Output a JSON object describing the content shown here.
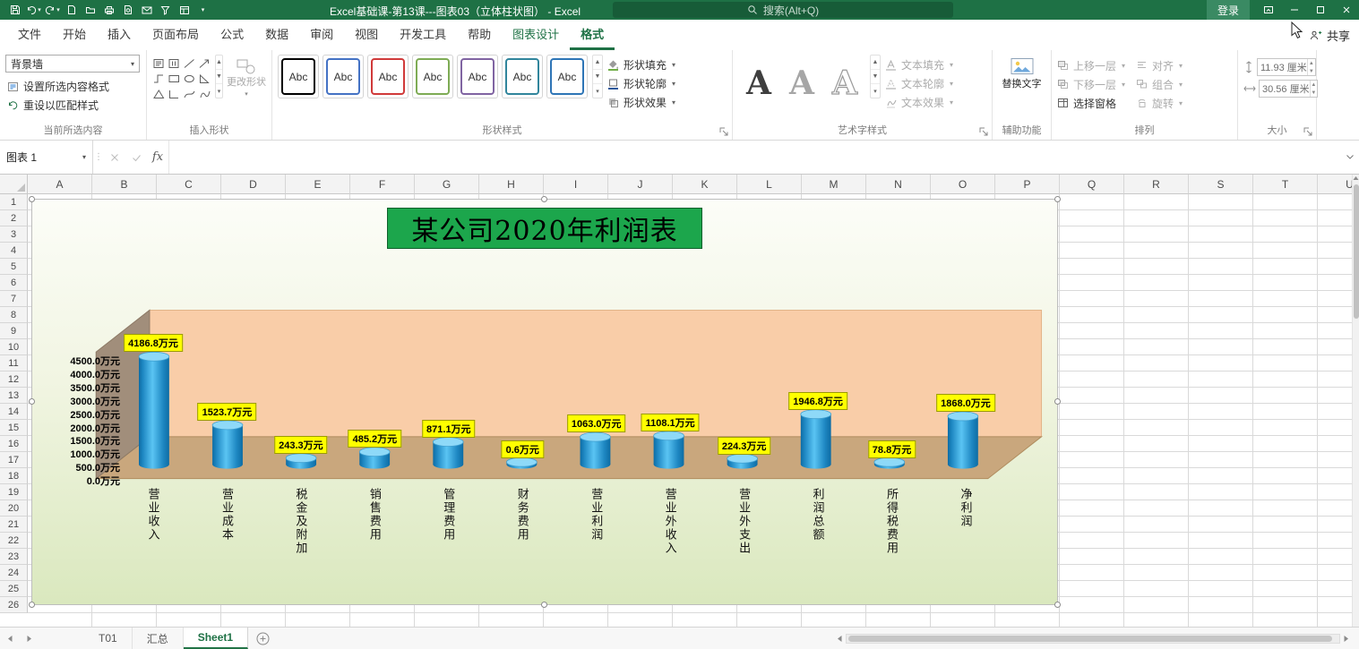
{
  "titlebar": {
    "title": "Excel基础课-第13课---图表03（立体柱状图） - Excel",
    "search_placeholder": "搜索(Alt+Q)",
    "login_label": "登录"
  },
  "icons": {
    "caret_down": "▾",
    "arrow_up": "▲",
    "arrow_down": "▼",
    "dots_vertical": "⋮"
  },
  "ribbon": {
    "share_label": "共享",
    "tabs": [
      {
        "id": "file",
        "label": "文件"
      },
      {
        "id": "home",
        "label": "开始"
      },
      {
        "id": "insert",
        "label": "插入"
      },
      {
        "id": "page-layout",
        "label": "页面布局"
      },
      {
        "id": "formulas",
        "label": "公式"
      },
      {
        "id": "data",
        "label": "数据"
      },
      {
        "id": "review",
        "label": "审阅"
      },
      {
        "id": "view",
        "label": "视图"
      },
      {
        "id": "developer",
        "label": "开发工具"
      },
      {
        "id": "help",
        "label": "帮助"
      },
      {
        "id": "chart-design",
        "label": "图表设计",
        "contextual": true
      },
      {
        "id": "format",
        "label": "格式",
        "contextual": true,
        "active": true
      }
    ],
    "groups": {
      "current_selection": {
        "label": "当前所选内容",
        "selector_value": "背景墙",
        "format_button": "设置所选内容格式",
        "reset_button": "重设以匹配样式"
      },
      "insert_shapes": {
        "label": "插入形状",
        "change_shape_button": "更改形状",
        "shapes": [
          "text-box",
          "vertical-text-box",
          "line",
          "arrow",
          "connector",
          "rectangle",
          "oval",
          "right-triangle",
          "triangle",
          "l-shape",
          "curve",
          "scribble"
        ]
      },
      "shape_styles": {
        "label": "形状样式",
        "fill_button": "形状填充",
        "outline_button": "形状轮廓",
        "effects_button": "形状效果",
        "presets": [
          {
            "label": "Abc",
            "border_color": "#000000"
          },
          {
            "label": "Abc",
            "border_color": "#4472C4"
          },
          {
            "label": "Abc",
            "border_color": "#D03A3A"
          },
          {
            "label": "Abc",
            "border_color": "#7EAB55"
          },
          {
            "label": "Abc",
            "border_color": "#8064A2"
          },
          {
            "label": "Abc",
            "border_color": "#31859C"
          },
          {
            "label": "Abc",
            "border_color": "#2E75B6"
          }
        ]
      },
      "wordart_styles": {
        "label": "艺术字样式",
        "text_fill_button": "文本填充",
        "text_outline_button": "文本轮廓",
        "text_effects_button": "文本效果",
        "samples": [
          {
            "label": "A",
            "style": "dark"
          },
          {
            "label": "A",
            "style": "gray"
          },
          {
            "label": "A",
            "style": "outline"
          }
        ]
      },
      "accessibility": {
        "label": "辅助功能",
        "alt_text_button": "替换文字"
      },
      "arrange": {
        "label": "排列",
        "bring_forward": "上移一层",
        "send_backward": "下移一层",
        "selection_pane": "选择窗格",
        "align": "对齐",
        "group": "组合",
        "rotate": "旋转"
      },
      "size": {
        "label": "大小",
        "height_value": "11.93 厘米",
        "width_value": "30.56 厘米"
      }
    }
  },
  "formula_bar": {
    "name_box": "图表 1",
    "fx_label": "fx"
  },
  "grid": {
    "columns": [
      "A",
      "B",
      "C",
      "D",
      "E",
      "F",
      "G",
      "H",
      "I",
      "J",
      "K",
      "L",
      "M",
      "N",
      "O",
      "P",
      "Q",
      "R",
      "S",
      "T",
      "U"
    ],
    "rows": [
      1,
      2,
      3,
      4,
      5,
      6,
      7,
      8,
      9,
      10,
      11,
      12,
      13,
      14,
      15,
      16,
      17,
      18,
      19,
      20,
      21,
      22,
      23,
      24,
      25,
      26
    ]
  },
  "chart_data": {
    "type": "bar",
    "subtype": "3d-cylinder",
    "title": "某公司2020年利润表",
    "unit": "万元",
    "categories": [
      "营业收入",
      "营业成本",
      "税金及附加",
      "销售费用",
      "管理费用",
      "财务费用",
      "营业利润",
      "营业外收入",
      "营业外支出",
      "利润总额",
      "所得税费用",
      "净利润"
    ],
    "values": [
      4186.8,
      1523.7,
      243.3,
      485.2,
      871.1,
      0.6,
      1063.0,
      1108.1,
      224.3,
      1946.8,
      78.8,
      1868.0
    ],
    "data_labels": [
      "4186.8万元",
      "1523.7万元",
      "243.3万元",
      "485.2万元",
      "871.1万元",
      "0.6万元",
      "1063.0万元",
      "1108.1万元",
      "224.3万元",
      "1946.8万元",
      "78.8万元",
      "1868.0万元"
    ],
    "ylim": [
      0,
      4500
    ],
    "ytick_step": 500,
    "yticks": [
      "4500.0万元",
      "4000.0万元",
      "3500.0万元",
      "3000.0万元",
      "2500.0万元",
      "2000.0万元",
      "1500.0万元",
      "1000.0万元",
      "500.0万元",
      "0.0万元"
    ],
    "legend": "none",
    "colors": {
      "cylinder_dark": "#0D6CA4",
      "cylinder_mid": "#1E87C2",
      "cylinder_light": "#5AC4F3",
      "cylinder_top": "#8ED9F8",
      "cylinder_top_border": "#3E9FD0",
      "wall": "#F9CDA8",
      "wall_border": "#E2B489",
      "floor": "#C9A77D",
      "floor_border": "#B08D5F",
      "side_wall": "#A18E7B",
      "side_wall_border": "#8D7A66",
      "label_bg": "#FFFF00",
      "label_border": "#9A9A00",
      "title_bg": "#1CA64C",
      "title_border": "#0E5F2B"
    }
  },
  "sheet_bar": {
    "tabs": [
      {
        "id": "t01",
        "label": "T01"
      },
      {
        "id": "huizong",
        "label": "汇总"
      },
      {
        "id": "sheet1",
        "label": "Sheet1",
        "active": true
      }
    ]
  },
  "theme": {
    "excel_green": "#217346",
    "titlebar_green": "#1E7145"
  }
}
